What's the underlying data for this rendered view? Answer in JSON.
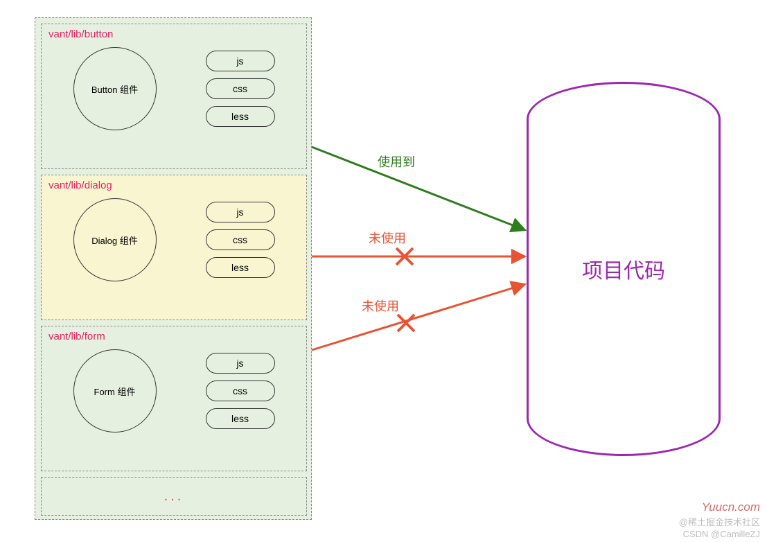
{
  "modules": [
    {
      "title": "vant/lib/button",
      "circle": "Button 组件",
      "bg": "green"
    },
    {
      "title": "vant/lib/dialog",
      "circle": "Dialog 组件",
      "bg": "yellow"
    },
    {
      "title": "vant/lib/form",
      "circle": "Form 组件",
      "bg": "green"
    }
  ],
  "pills": [
    "js",
    "css",
    "less"
  ],
  "ellipsis": "...",
  "target": "项目代码",
  "edges": {
    "used": "使用到",
    "unused1": "未使用",
    "unused2": "未使用"
  },
  "watermarks": {
    "right": "Yuucn.com",
    "line1": "@稀土掘金技术社区",
    "line2": "CSDN @CamilleZJ"
  },
  "colors": {
    "green_arrow": "#2e7d1f",
    "red_arrow": "#e85332",
    "purple": "#9c27b0",
    "pink": "#e91e63"
  }
}
